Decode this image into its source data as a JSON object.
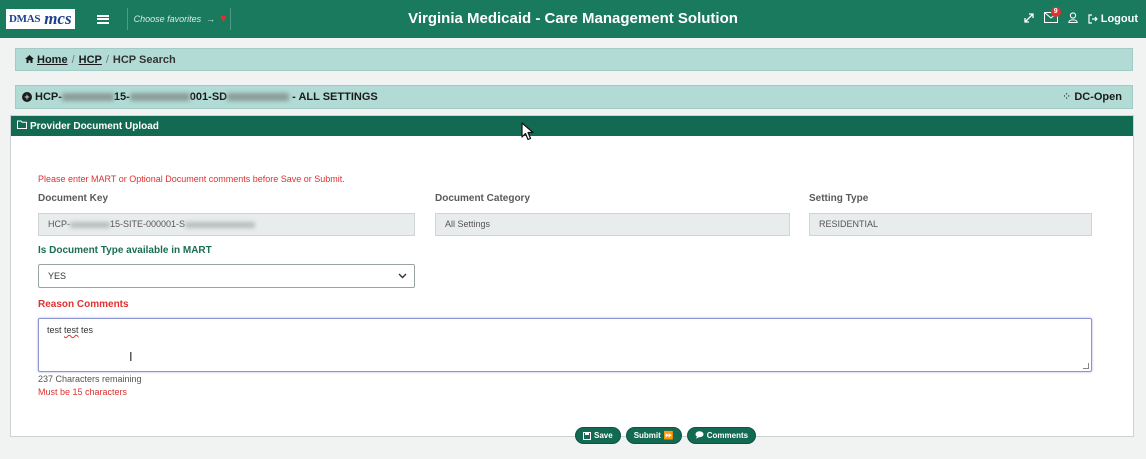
{
  "topbar": {
    "logo_dmas": "DMAS",
    "logo_mcs": "mcs",
    "favorites_placeholder": "Choose favorites",
    "title": "Virginia Medicaid - Care Management Solution",
    "mail_count": "9",
    "logout_label": "Logout"
  },
  "breadcrumb": {
    "home": "Home",
    "hcp": "HCP",
    "current": "HCP Search"
  },
  "hcp_header": {
    "prefix": "HCP-",
    "part1": "15-",
    "part2": "001-SD",
    "suffix": " - ALL SETTINGS",
    "status": "DC-Open"
  },
  "panel": {
    "title": "Provider Document Upload",
    "warning": "Please enter MART or Optional Document comments before Save or Submit.",
    "document_key_label": "Document Key",
    "document_key_prefix": "HCP-",
    "document_key_mid": "15-SITE-000001-S",
    "document_category_label": "Document Category",
    "document_category_value": "All Settings",
    "setting_type_label": "Setting Type",
    "setting_type_value": "RESIDENTIAL",
    "mart_label": "Is Document Type available in MART",
    "mart_value": "YES",
    "reason_label": "Reason Comments",
    "reason_text_a": "test ",
    "reason_text_b": "test",
    "reason_text_c": " tes",
    "chars_remaining": "237 Characters remaining",
    "validation": "Must be 15 characters"
  },
  "buttons": {
    "save": "Save",
    "submit": "Submit",
    "comments": "Comments"
  },
  "colors": {
    "topbar": "#1a7a5e",
    "panel_header": "#136a52",
    "bar_bg": "#b2dbd6",
    "error": "#e03131"
  }
}
